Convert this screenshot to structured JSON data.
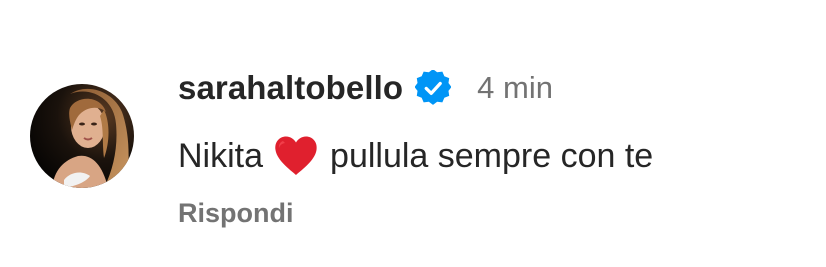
{
  "comment": {
    "username": "sarahaltobello",
    "timestamp": "4 min",
    "text_before_emoji": "Nikita",
    "emoji": "red-heart",
    "text_after_emoji": "pullula sempre con te",
    "reply_label": "Rispondi",
    "verified": true,
    "verified_icon": "verified-badge-icon",
    "colors": {
      "verified_badge": "#0095F6",
      "heart": "#E0202E",
      "secondary_text": "#737373",
      "primary_text": "#262626"
    }
  }
}
